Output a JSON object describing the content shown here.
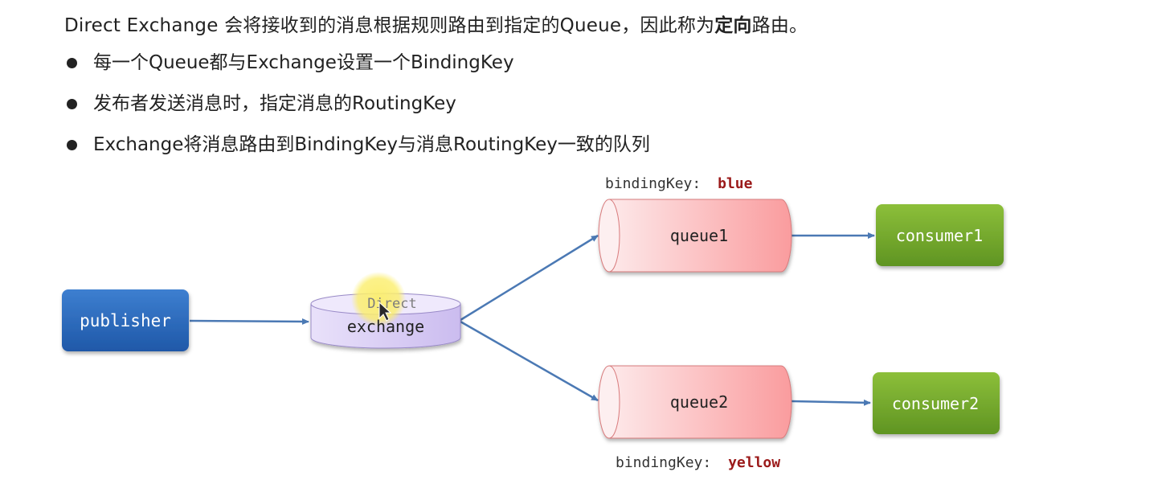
{
  "intro": {
    "part1": "Direct Exchange 会将接收到的消息根据规则路由到指定的Queue，因此称为",
    "bold": "定向",
    "part2": "路由。"
  },
  "bullets": [
    "每一个Queue都与Exchange设置一个BindingKey",
    "发布者发送消息时，指定消息的RoutingKey",
    "Exchange将消息路由到BindingKey与消息RoutingKey一致的队列"
  ],
  "diagram": {
    "publisher": "publisher",
    "exchange_type": "Direct",
    "exchange": "exchange",
    "queue1": "queue1",
    "queue2": "queue2",
    "consumer1": "consumer1",
    "consumer2": "consumer2",
    "binding_label": "bindingKey:",
    "binding1_value": "blue",
    "binding2_value": "yellow"
  },
  "colors": {
    "publisher": "#2f6cbf",
    "exchange": "#dcd0f4",
    "queue": "#fbb3b4",
    "consumer": "#78aa2c",
    "arrow": "#4b79b4",
    "binding_value": "#9b1a1a",
    "cursor_highlight": "#fbee6c"
  }
}
